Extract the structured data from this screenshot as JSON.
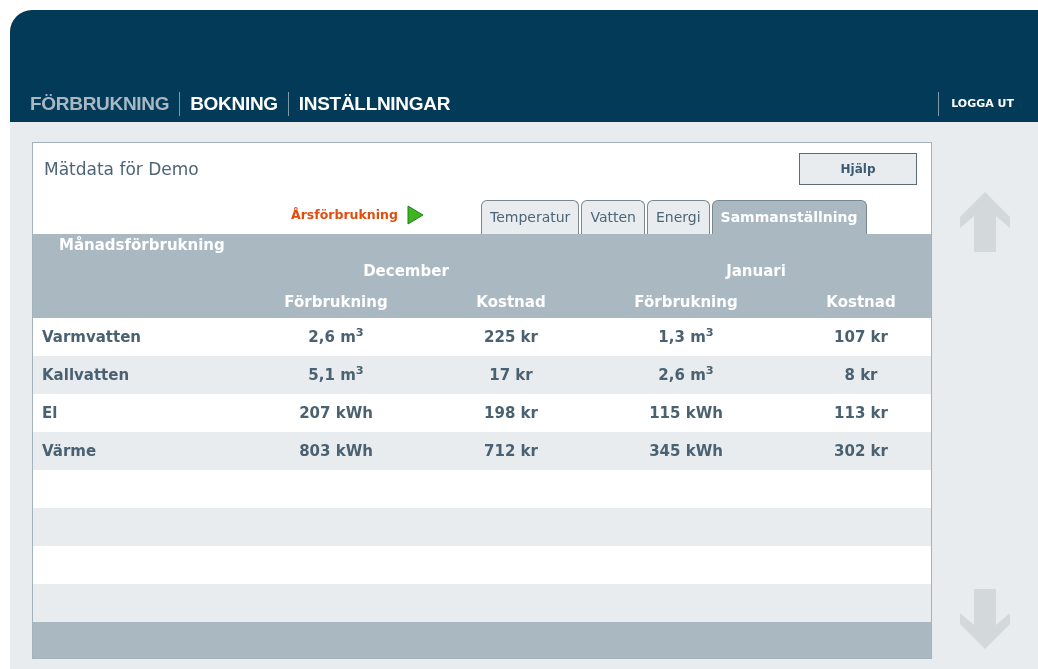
{
  "nav": [
    {
      "label": "FÖRBRUKNING",
      "selected": true
    },
    {
      "label": "BOKNING",
      "selected": false
    },
    {
      "label": "INSTÄLLNINGAR",
      "selected": false
    }
  ],
  "logout": "LOGGA UT",
  "panel": {
    "title": "Mätdata för Demo",
    "help_button": "Hjälp",
    "year_link": "Årsförbrukning"
  },
  "tabs": [
    {
      "label": "Temperatur",
      "selected": false
    },
    {
      "label": "Vatten",
      "selected": false
    },
    {
      "label": "Energi",
      "selected": false
    },
    {
      "label": "Sammanställning",
      "selected": true
    }
  ],
  "table": {
    "caption": "Månadsförbrukning",
    "months": [
      "December",
      "Januari"
    ],
    "columns": [
      "",
      "Förbrukning",
      "Kostnad",
      "Förbrukning",
      "Kostnad"
    ],
    "rows": [
      [
        "Varmvatten",
        "2,6 m$^{3}$",
        "225 kr",
        "1,3 m$^{3}$",
        "107 kr"
      ],
      [
        "Kallvatten",
        "5,1 m$^{3}$",
        "17 kr",
        "2,6 m$^{3}$",
        "8 kr"
      ],
      [
        "El",
        "207 kWh",
        "198 kr",
        "115 kWh",
        "113 kr"
      ],
      [
        "Värme",
        "803 kWh",
        "712 kr",
        "345 kWh",
        "302 kr"
      ]
    ]
  }
}
